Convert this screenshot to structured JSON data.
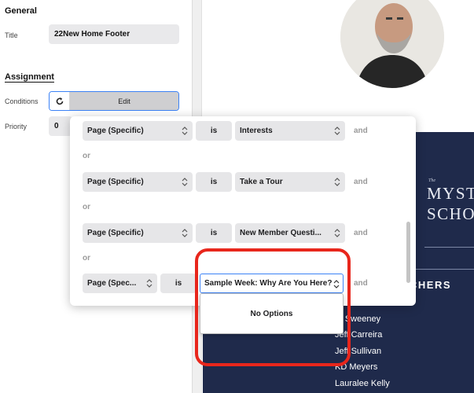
{
  "settings": {
    "general_heading": "General",
    "title_label": "Title",
    "title_value": "22New Home Footer",
    "assignment_heading": "Assignment",
    "conditions_label": "Conditions",
    "edit_label": "Edit",
    "priority_label": "Priority",
    "priority_value": "0"
  },
  "conditions": {
    "rows": [
      {
        "field": "Page (Specific)",
        "operator": "is",
        "value": "Interests",
        "joiner": "and"
      },
      {
        "field": "Page (Specific)",
        "operator": "is",
        "value": "Take a Tour",
        "joiner": "and"
      },
      {
        "field": "Page (Specific)",
        "operator": "is",
        "value": "New Member Questi...",
        "joiner": "and"
      },
      {
        "field": "Page (Spec...",
        "operator": "is",
        "value": "Sample Week: Why Are You Here?",
        "joiner": "and"
      }
    ],
    "or_label": "or",
    "dropdown_empty": "No Options"
  },
  "preview": {
    "brand_small": "The",
    "brand_line1": "MYST",
    "brand_line2": "SCHO",
    "teachers_heading": "CHERS",
    "teachers": [
      "rd Sweeney",
      "Jeff Carreira",
      "Jeff Sullivan",
      "KD Meyers",
      "Lauralee Kelly"
    ]
  },
  "colors": {
    "accent": "#3b82f6",
    "annotation": "#e8261c",
    "navy": "#1f2a4b"
  },
  "icons": {
    "conditions_icon": "refresh-icon",
    "select_icon": "chevron-updown-icon"
  }
}
